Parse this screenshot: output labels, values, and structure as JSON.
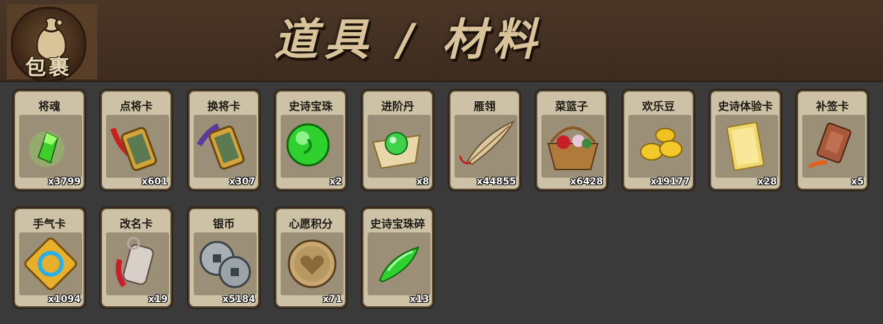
{
  "header": {
    "bag_label": "包裹",
    "title": "道具 / 材料"
  },
  "items": [
    {
      "name": "将魂",
      "count": "x3799",
      "icon": "green-crystal-icon"
    },
    {
      "name": "点将卡",
      "count": "x601",
      "icon": "recruit-card-icon"
    },
    {
      "name": "换将卡",
      "count": "x307",
      "icon": "swap-card-icon"
    },
    {
      "name": "史诗宝珠",
      "count": "x2",
      "icon": "green-orb-icon"
    },
    {
      "name": "进阶丹",
      "count": "x8",
      "icon": "advance-pill-icon"
    },
    {
      "name": "雁翎",
      "count": "x44855",
      "icon": "feather-icon"
    },
    {
      "name": "菜篮子",
      "count": "x6428",
      "icon": "basket-icon"
    },
    {
      "name": "欢乐豆",
      "count": "x19177",
      "icon": "gold-beans-icon"
    },
    {
      "name": "史诗体验卡",
      "count": "x28",
      "icon": "gold-card-icon"
    },
    {
      "name": "补签卡",
      "count": "x5",
      "icon": "sign-card-icon"
    },
    {
      "name": "手气卡",
      "count": "x1094",
      "icon": "luck-card-icon"
    },
    {
      "name": "改名卡",
      "count": "x19",
      "icon": "rename-card-icon"
    },
    {
      "name": "银币",
      "count": "x5184",
      "icon": "silver-coins-icon"
    },
    {
      "name": "心愿积分",
      "count": "x71",
      "icon": "heart-coin-icon"
    },
    {
      "name": "史诗宝珠碎",
      "count": "x13",
      "icon": "orb-shard-icon"
    }
  ]
}
